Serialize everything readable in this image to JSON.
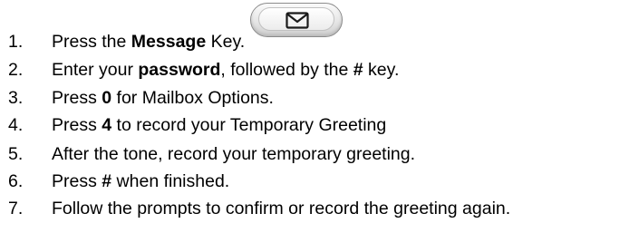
{
  "steps": [
    {
      "num": "1.",
      "parts": [
        "Press the ",
        "Message",
        " Key."
      ]
    },
    {
      "num": "2.",
      "parts": [
        "Enter your ",
        "password",
        ", followed by the ",
        "#",
        " key."
      ]
    },
    {
      "num": "3.",
      "parts": [
        "Press ",
        "0",
        " for Mailbox Options."
      ]
    },
    {
      "num": "4.",
      "parts": [
        "Press ",
        "4",
        " to record your Temporary Greeting"
      ]
    },
    {
      "num": "5.",
      "parts": [
        "After the tone, record your temporary greeting."
      ]
    },
    {
      "num": "6.",
      "parts": [
        "Press ",
        "#",
        " when finished."
      ]
    },
    {
      "num": "7.",
      "parts": [
        "Follow the prompts to confirm or record the greeting again."
      ]
    }
  ],
  "message_key": {
    "icon": "envelope-icon"
  }
}
